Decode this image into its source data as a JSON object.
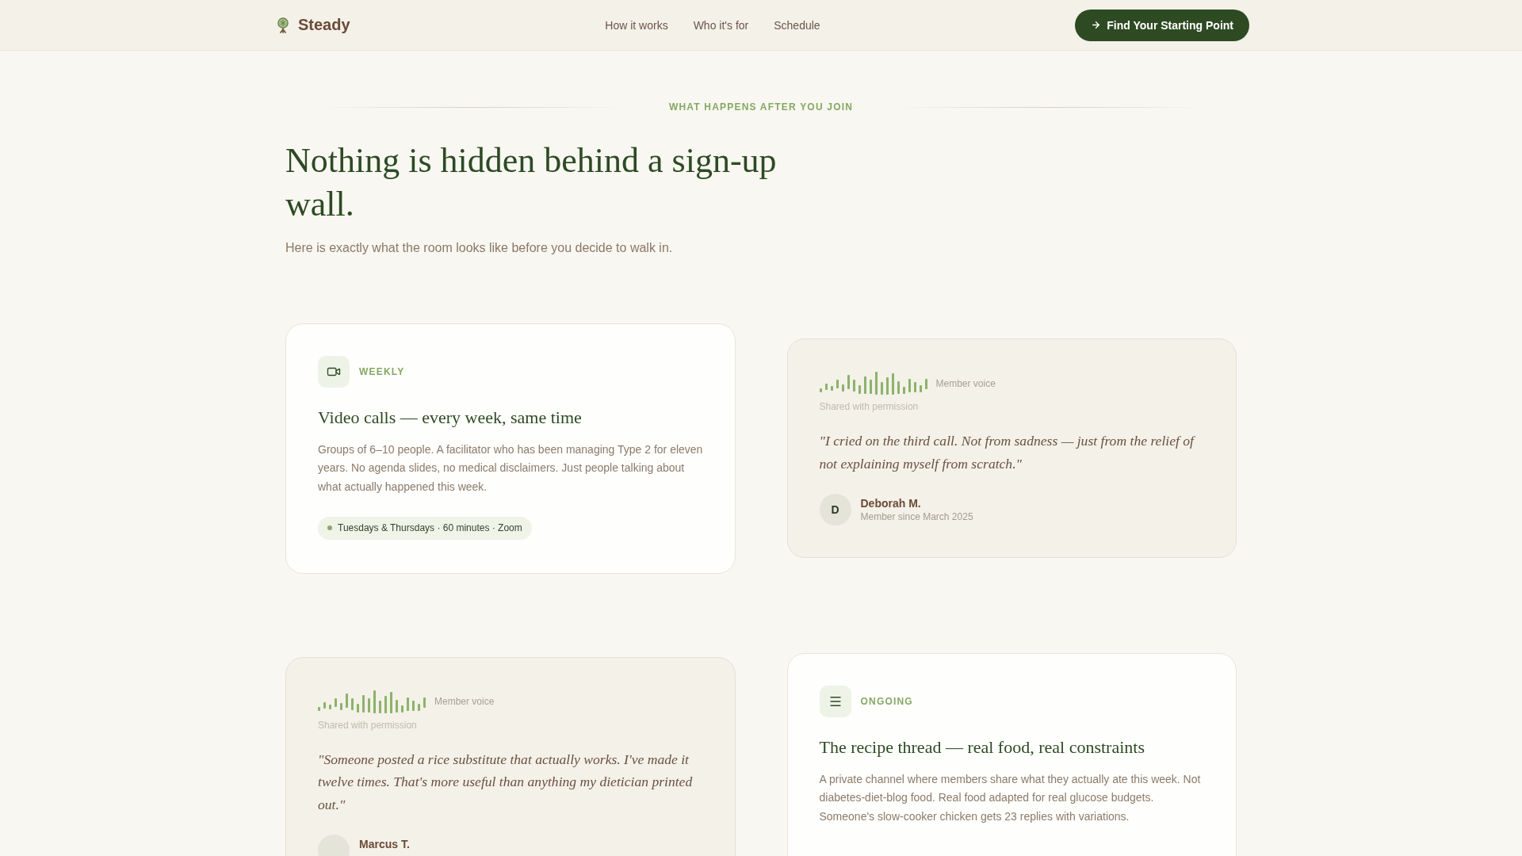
{
  "nav": {
    "logo": "Steady",
    "links": [
      {
        "label": "How it works"
      },
      {
        "label": "Who it's for"
      },
      {
        "label": "Schedule"
      }
    ],
    "cta": "Find Your Starting Point"
  },
  "section": {
    "eyebrow": "WHAT HAPPENS AFTER YOU JOIN",
    "heading": "Nothing is hidden behind a sign-up wall.",
    "subtitle": "Here is exactly what the room looks like before you decide to walk in."
  },
  "cards": [
    {
      "kind": "feature",
      "label": "WEEKLY",
      "title": "Video calls — every week, same time",
      "description": "Groups of 6–10 people. A facilitator who has been managing Type 2 for eleven years. No agenda slides, no medical disclaimers. Just people talking about what actually happened this week.",
      "chip": "Tuesdays & Thursdays · 60 minutes · Zoom"
    },
    {
      "kind": "quote",
      "tag": "Member voice",
      "note": "Shared with permission",
      "quote": "\"I cried on the third call. Not from sadness — just from the relief of not explaining myself from scratch.\"",
      "author": {
        "initial": "D",
        "name": "Deborah M.",
        "since": "Member since March 2025"
      }
    },
    {
      "kind": "quote",
      "tag": "Member voice",
      "note": "Shared with permission",
      "quote": "\"Someone posted a rice substitute that actually works. I've made it twelve times. That's more useful than anything my dietician printed out.\"",
      "author": {
        "name": "Marcus T."
      }
    },
    {
      "kind": "feature",
      "label": "ONGOING",
      "title": "The recipe thread — real food, real constraints",
      "description": "A private channel where members share what they actually ate this week. Not diabetes-diet-blog food. Real food adapted for real glucose budgets. Someone's slow-cooker chicken gets 23 replies with variations."
    }
  ]
}
